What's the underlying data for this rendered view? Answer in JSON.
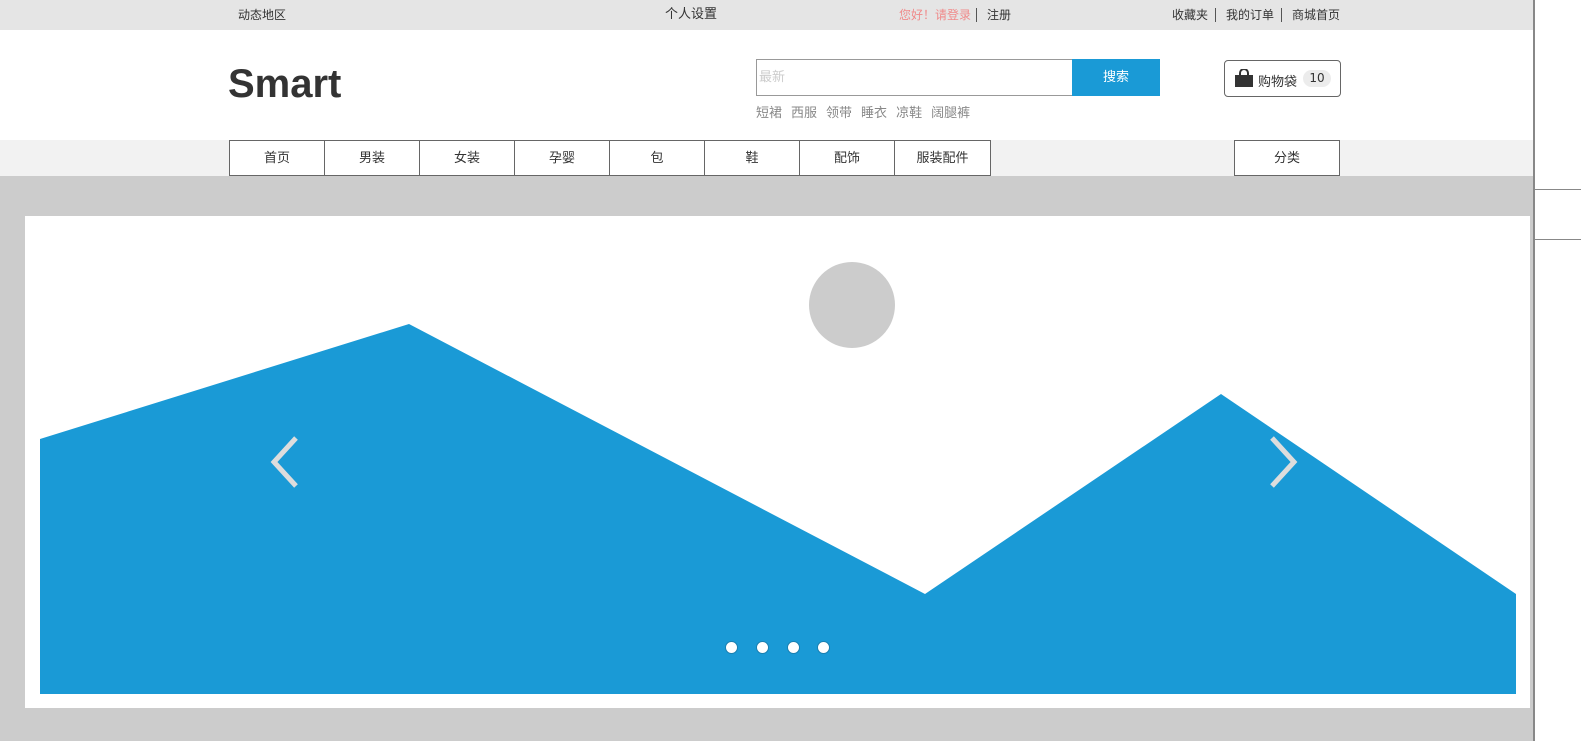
{
  "topbar": {
    "region": "动态地区",
    "personal_settings": "个人设置",
    "greeting": "您好！请登录",
    "register": "注册",
    "favorites": "收藏夹",
    "my_orders": "我的订单",
    "mall_home": "商城首页",
    "greeting_color": "#f08a8a"
  },
  "header": {
    "logo": "Smart",
    "search": {
      "placeholder": "最新",
      "value": "",
      "button": "搜索"
    },
    "hot_keywords": [
      "短裙",
      "西服",
      "领带",
      "睡衣",
      "凉鞋",
      "阔腿裤"
    ],
    "cart": {
      "icon": "shopping-bag-icon",
      "label": "购物袋",
      "count": "10"
    }
  },
  "nav": {
    "items": [
      "首页",
      "男装",
      "女装",
      "孕婴",
      "包",
      "鞋",
      "配饰",
      "服装配件"
    ],
    "category": "分类"
  },
  "carousel": {
    "prev_icon": "chevron-left-icon",
    "next_icon": "chevron-right-icon",
    "indicator_count": 4,
    "colors": {
      "mountain": "#1a9ad6",
      "sun": "#cccccc",
      "background": "#cccccc"
    }
  }
}
